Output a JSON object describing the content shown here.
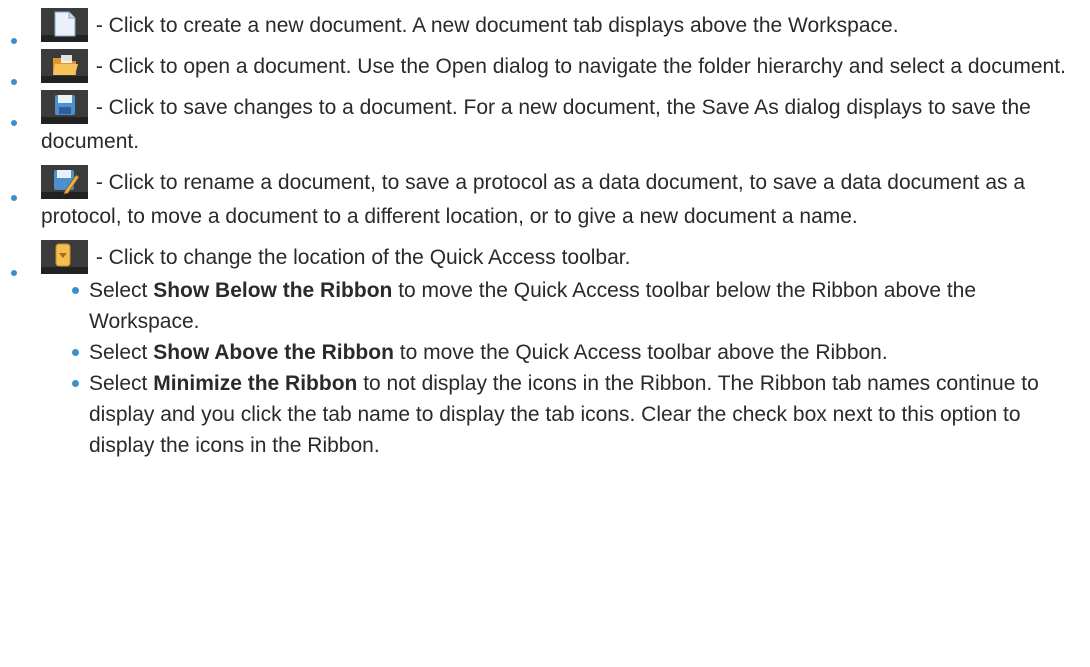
{
  "items": [
    {
      "icon": "new-document-icon",
      "text": " - Click to create a new document. A new document tab displays above the Workspace."
    },
    {
      "icon": "open-folder-icon",
      "text": " - Click to open a document. Use the Open dialog to navigate the folder hierarchy and select a document."
    },
    {
      "icon": "save-disk-icon",
      "text": " - Click to save changes to a document. For a new document, the Save As dialog displays to save the document."
    },
    {
      "icon": "save-as-rename-icon",
      "text": " - Click to rename a document, to save a protocol as a data document, to save a data document as a protocol, to move a document to a different location, or to give a new document a name."
    },
    {
      "icon": "customize-toolbar-icon",
      "text": " - Click to change the location of the Quick Access toolbar."
    }
  ],
  "subitems": [
    {
      "pre": "Select ",
      "bold": "Show Below the Ribbon",
      "post": " to move the Quick Access toolbar below the Ribbon above the Workspace."
    },
    {
      "pre": "Select ",
      "bold": "Show Above the Ribbon",
      "post": " to move the Quick Access toolbar above the Ribbon."
    },
    {
      "pre": "Select ",
      "bold": "Minimize the Ribbon",
      "post": " to not display the icons in the Ribbon. The Ribbon tab names continue to display and you click the tab name to display the tab icons. Clear the check box next to this option to display the icons in the Ribbon."
    }
  ],
  "colors": {
    "bullet": "#3a8fcc",
    "text": "#2a2a2a"
  }
}
